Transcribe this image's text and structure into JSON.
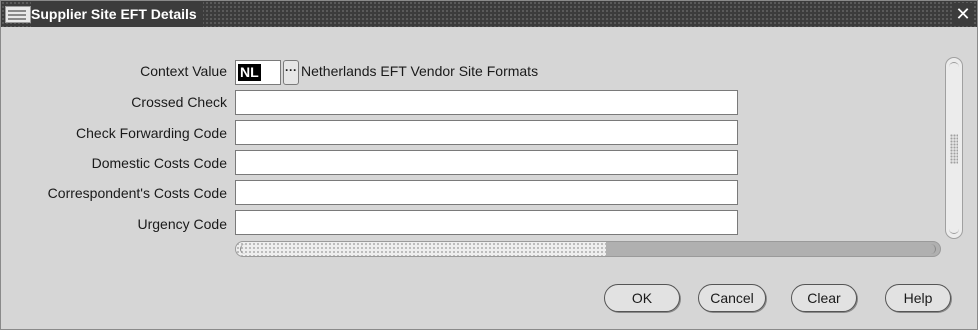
{
  "window": {
    "title": "Supplier Site EFT Details",
    "close_glyph": "✕"
  },
  "form": {
    "context_label": "Context Value",
    "context_value": "NL",
    "lov_glyph": "···",
    "context_description": "Netherlands EFT Vendor Site Formats",
    "fields": [
      {
        "label": "Crossed Check",
        "value": ""
      },
      {
        "label": "Check Forwarding Code",
        "value": ""
      },
      {
        "label": "Domestic Costs Code",
        "value": ""
      },
      {
        "label": "Correspondent's Costs Code",
        "value": ""
      },
      {
        "label": "Urgency Code",
        "value": ""
      }
    ]
  },
  "buttons": {
    "ok": "OK",
    "cancel": "Cancel",
    "clear": "Clear",
    "help": "Help"
  },
  "icons": {
    "app": "oracle-form-icon",
    "close": "close-icon",
    "lov": "ellipsis-icon"
  }
}
